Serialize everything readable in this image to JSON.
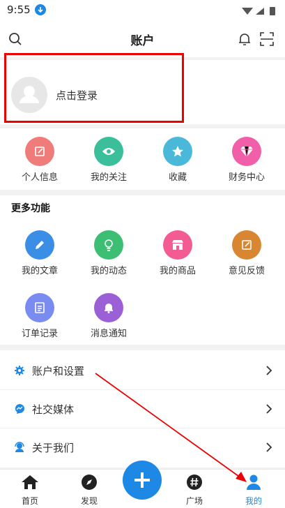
{
  "status": {
    "time": "9:55"
  },
  "header": {
    "title": "账户"
  },
  "login": {
    "text": "点击登录"
  },
  "quick": [
    {
      "label": "个人信息",
      "color": "#f07b7b",
      "icon": "edit-icon"
    },
    {
      "label": "我的关注",
      "color": "#3bbf9a",
      "icon": "eye-icon"
    },
    {
      "label": "收藏",
      "color": "#4ab8d9",
      "icon": "star-icon"
    },
    {
      "label": "财务中心",
      "color": "#f15fa8",
      "icon": "diamond-icon"
    }
  ],
  "more": {
    "title": "更多功能",
    "items": [
      {
        "label": "我的文章",
        "color": "#3a8ee6",
        "icon": "pencil-icon"
      },
      {
        "label": "我的动态",
        "color": "#3cbf73",
        "icon": "bulb-icon"
      },
      {
        "label": "我的商品",
        "color": "#f35c93",
        "icon": "shop-icon"
      },
      {
        "label": "意见反馈",
        "color": "#d98632",
        "icon": "feedback-icon"
      },
      {
        "label": "订单记录",
        "color": "#7b8cf0",
        "icon": "order-icon"
      },
      {
        "label": "消息通知",
        "color": "#9b5fd6",
        "icon": "bell-icon"
      }
    ]
  },
  "menu": [
    {
      "label": "账户和设置",
      "icon": "settings-gear-icon"
    },
    {
      "label": "社交媒体",
      "icon": "messenger-icon"
    },
    {
      "label": "关于我们",
      "icon": "support-icon"
    }
  ],
  "tabs": [
    {
      "label": "首页",
      "icon": "home-icon"
    },
    {
      "label": "发现",
      "icon": "compass-icon"
    },
    {
      "label": "广场",
      "icon": "hashtag-icon"
    },
    {
      "label": "我的",
      "icon": "user-icon",
      "active_color": "#1e88e5"
    }
  ],
  "accent": "#1e88e5"
}
